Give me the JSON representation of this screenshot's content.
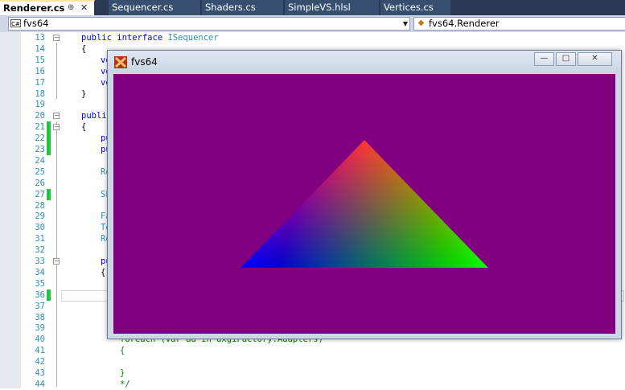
{
  "tabs": [
    {
      "label": "Renderer.cs",
      "active": true
    },
    {
      "label": "Sequencer.cs",
      "active": false
    },
    {
      "label": "Shaders.cs",
      "active": false
    },
    {
      "label": "SimpleVS.hlsl",
      "active": false
    },
    {
      "label": "Vertices.cs",
      "active": false
    }
  ],
  "tab_pin_icon": "pin-icon",
  "tab_close_icon": "close-icon",
  "nav": {
    "project_label": "fvs64",
    "project_icon_text": "C#",
    "member_label": "fvs64.Renderer"
  },
  "editor": {
    "line_numbers": [
      "13",
      "14",
      "15",
      "16",
      "17",
      "18",
      "19",
      "20",
      "21",
      "22",
      "23",
      "24",
      "25",
      "26",
      "27",
      "28",
      "29",
      "30",
      "31",
      "32",
      "33",
      "34",
      "35",
      "36",
      "37",
      "38",
      "39",
      "40",
      "41",
      "42",
      "43",
      "44"
    ],
    "changed_lines": [
      "21",
      "22",
      "23",
      "27",
      "36"
    ],
    "fold_lines": [
      "13",
      "20",
      "21",
      "33"
    ],
    "code": {
      "l13_kw": "public interface",
      "l13_type": "ISequencer",
      "l14": "{",
      "l15": "vo",
      "l16": "vo",
      "l17": "vo",
      "l18": "}",
      "l20": "publi",
      "l21": "{",
      "l22": "pu",
      "l23": "pu",
      "l25": "Re",
      "l27": "Sh",
      "l29": "Fa",
      "l30": "Te",
      "l31": "Re",
      "l33": "pu",
      "l34": "{",
      "l40": "foreach (var ad in dxgiFactory.Adapters)",
      "l41": "{",
      "l43": "}",
      "l44": "*/"
    }
  },
  "window": {
    "title": "fvs64",
    "buttons": {
      "minimize": "—",
      "maximize": "□",
      "close": "✕"
    },
    "client_color": "#800080",
    "triangle_colors": {
      "top": "#ff0000",
      "left": "#0000ff",
      "right": "#00ff00"
    }
  },
  "colors": {
    "tabbar": "#293955",
    "navbar": "#cfd6e5",
    "line_numbers": "#2b91af",
    "change_marker": "#25c43f"
  }
}
